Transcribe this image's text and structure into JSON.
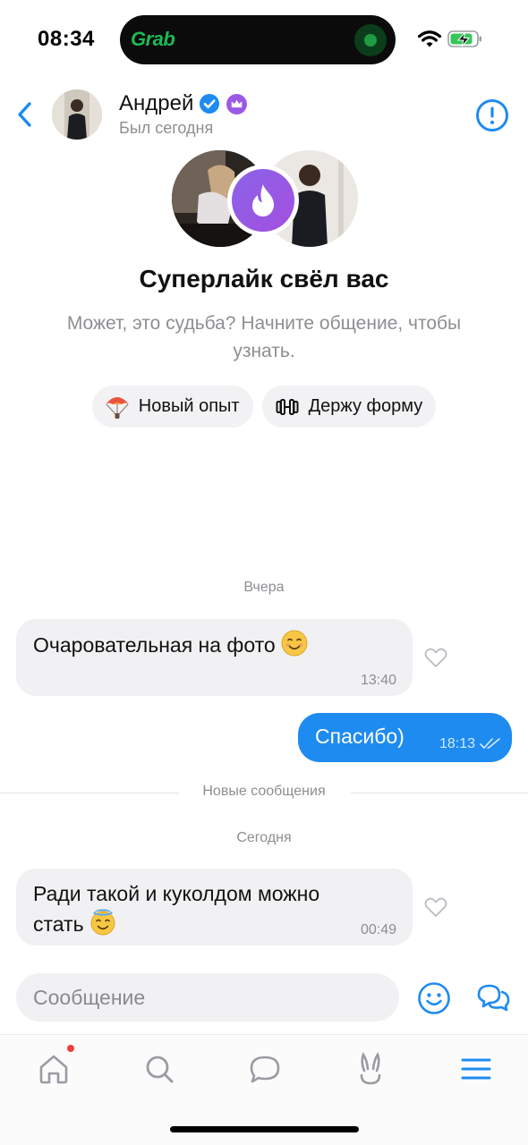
{
  "status_bar": {
    "time": "08:34",
    "island_app": "Grab",
    "icons": [
      "wifi-icon",
      "battery-charging-icon"
    ]
  },
  "header": {
    "name": "Андрей",
    "subtitle": "Был сегодня",
    "badges": [
      "verified-check-icon",
      "crown-premium-icon"
    ],
    "back_icon": "chevron-left-icon",
    "action_icon": "alert-circle-icon"
  },
  "match": {
    "title": "Суперлайк свёл вас",
    "description": "Может, это судьба? Начните общение, чтобы узнать.",
    "badge_icon": "flame-icon"
  },
  "chips": [
    {
      "label": "Новый опыт",
      "icon": "parachute-icon"
    },
    {
      "label": "Держу форму",
      "icon": "dumbbell-icon"
    }
  ],
  "chat": {
    "day_yesterday": "Вчера",
    "msg1": {
      "text": "Очаровательная на фото",
      "emoji": "smiling-face-emoji",
      "time": "13:40"
    },
    "msg2": {
      "text": "Спасибо)",
      "time": "18:13",
      "read": true
    },
    "new_messages_label": "Новые сообщения",
    "day_today": "Сегодня",
    "msg3": {
      "text": "Ради такой и куколдом можно стать",
      "emoji": "halo-face-emoji",
      "time": "00:49"
    }
  },
  "composer": {
    "placeholder": "Сообщение",
    "value": ""
  },
  "tabbar": [
    "home-icon",
    "search-icon",
    "chat-icon",
    "bunny-icon",
    "menu-icon"
  ],
  "colors": {
    "accent": "#1E8BF0",
    "bubble_in": "#F1F1F3",
    "muted": "#8E8E93",
    "superlike": "#9B59E6",
    "notification": "#F23D3D"
  }
}
